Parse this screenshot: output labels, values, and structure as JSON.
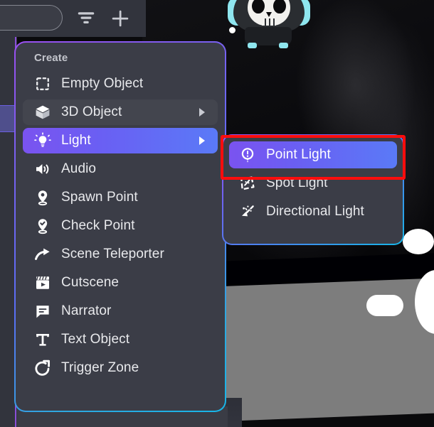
{
  "app": {
    "scene_background": "#0a0a0c",
    "panel_background": "#3b3d47",
    "accent_purple": "#7a53f0",
    "accent_blue": "#5a7af7",
    "accent_cyan": "#17b6e8",
    "annotation_color": "#ff0d0d"
  },
  "toolbar": {
    "search_placeholder": "",
    "search_value": "",
    "filter_icon": "filter-icon",
    "add_icon": "plus-icon"
  },
  "menu": {
    "title": "Create",
    "items": [
      {
        "label": "Empty Object",
        "icon": "empty-object-icon",
        "has_submenu": false,
        "state": "normal"
      },
      {
        "label": "3D Object",
        "icon": "cube-icon",
        "has_submenu": true,
        "state": "hover"
      },
      {
        "label": "Light",
        "icon": "lightbulb-icon",
        "has_submenu": true,
        "state": "active"
      },
      {
        "label": "Audio",
        "icon": "speaker-icon",
        "has_submenu": false,
        "state": "normal"
      },
      {
        "label": "Spawn Point",
        "icon": "map-pin-icon",
        "has_submenu": false,
        "state": "normal"
      },
      {
        "label": "Check Point",
        "icon": "pin-check-icon",
        "has_submenu": false,
        "state": "normal"
      },
      {
        "label": "Scene Teleporter",
        "icon": "arrow-curve-icon",
        "has_submenu": false,
        "state": "normal"
      },
      {
        "label": "Cutscene",
        "icon": "clapperboard-icon",
        "has_submenu": false,
        "state": "normal"
      },
      {
        "label": "Narrator",
        "icon": "speech-bubble-icon",
        "has_submenu": false,
        "state": "normal"
      },
      {
        "label": "Text Object",
        "icon": "text-t-icon",
        "has_submenu": false,
        "state": "normal"
      },
      {
        "label": "Trigger Zone",
        "icon": "trigger-arrow-icon",
        "has_submenu": false,
        "state": "normal"
      }
    ]
  },
  "submenu": {
    "parent": "Light",
    "items": [
      {
        "label": "Point Light",
        "icon": "point-light-icon",
        "state": "active"
      },
      {
        "label": "Spot Light",
        "icon": "spot-light-icon",
        "state": "normal"
      },
      {
        "label": "Directional Light",
        "icon": "directional-light-icon",
        "state": "normal"
      }
    ]
  },
  "annotation": {
    "target": "Point Light",
    "shape": "rectangle"
  }
}
